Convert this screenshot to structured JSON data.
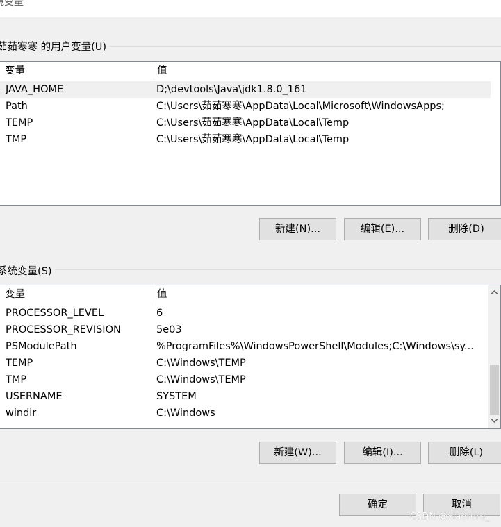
{
  "window": {
    "title_fragment": "境变量"
  },
  "user_vars": {
    "group_label": "茹茹寒寒 的用户变量(U)",
    "col_name": "变量",
    "col_value": "值",
    "rows": [
      {
        "name": "JAVA_HOME",
        "value": "D;\\devtools\\Java\\jdk1.8.0_161",
        "selected": true
      },
      {
        "name": "Path",
        "value": "C:\\Users\\茹茹寒寒\\AppData\\Local\\Microsoft\\WindowsApps;"
      },
      {
        "name": "TEMP",
        "value": "C:\\Users\\茹茹寒寒\\AppData\\Local\\Temp"
      },
      {
        "name": "TMP",
        "value": "C:\\Users\\茹茹寒寒\\AppData\\Local\\Temp"
      }
    ],
    "new_label": "新建(N)...",
    "edit_label": "编辑(E)...",
    "delete_label": "删除(D)"
  },
  "system_vars": {
    "group_label": "系统变量(S)",
    "col_name": "变量",
    "col_value": "值",
    "rows": [
      {
        "name": "PROCESSOR_LEVEL",
        "value": "6"
      },
      {
        "name": "PROCESSOR_REVISION",
        "value": "5e03"
      },
      {
        "name": "PSModulePath",
        "value": "%ProgramFiles%\\WindowsPowerShell\\Modules;C:\\Windows\\sy..."
      },
      {
        "name": "TEMP",
        "value": "C:\\Windows\\TEMP"
      },
      {
        "name": "TMP",
        "value": "C:\\Windows\\TEMP"
      },
      {
        "name": "USERNAME",
        "value": "SYSTEM"
      },
      {
        "name": "windir",
        "value": "C:\\Windows"
      }
    ],
    "new_label": "新建(W)...",
    "edit_label": "编辑(I)...",
    "delete_label": "删除(L)"
  },
  "footer": {
    "ok_label": "确定",
    "cancel_label": "取消"
  },
  "watermark": "CSDN @xiaoruru_",
  "icons": {
    "scroll_up": "chevron-up-icon",
    "scroll_down": "chevron-down-icon"
  }
}
